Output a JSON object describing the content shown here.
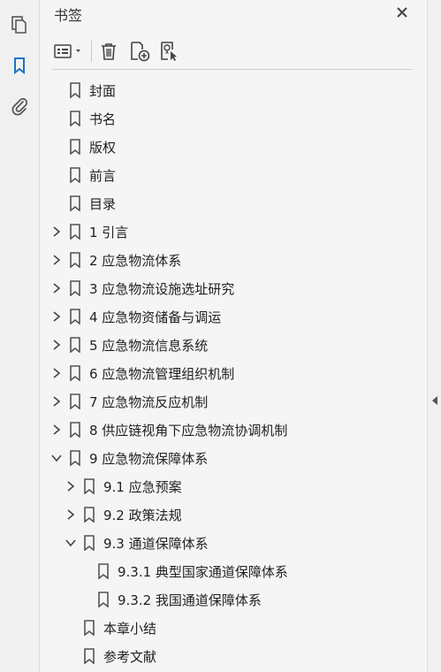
{
  "panel": {
    "title": "书签"
  },
  "rail": {
    "items": [
      "pages-icon",
      "bookmarks-icon",
      "attachments-icon"
    ]
  },
  "toolbar": {
    "items": [
      "options-menu",
      "delete-bookmark",
      "new-bookmark",
      "new-bookmark-from-structure"
    ]
  },
  "bookmarks": [
    {
      "label": "封面",
      "level": 0,
      "expander": "none"
    },
    {
      "label": "书名",
      "level": 0,
      "expander": "none"
    },
    {
      "label": "版权",
      "level": 0,
      "expander": "none"
    },
    {
      "label": "前言",
      "level": 0,
      "expander": "none"
    },
    {
      "label": "目录",
      "level": 0,
      "expander": "none"
    },
    {
      "label": "1  引言",
      "level": 0,
      "expander": "collapsed"
    },
    {
      "label": "2  应急物流体系",
      "level": 0,
      "expander": "collapsed"
    },
    {
      "label": "3  应急物流设施选址研究",
      "level": 0,
      "expander": "collapsed"
    },
    {
      "label": "4  应急物资储备与调运",
      "level": 0,
      "expander": "collapsed"
    },
    {
      "label": "5  应急物流信息系统",
      "level": 0,
      "expander": "collapsed"
    },
    {
      "label": "6  应急物流管理组织机制",
      "level": 0,
      "expander": "collapsed"
    },
    {
      "label": "7  应急物流反应机制",
      "level": 0,
      "expander": "collapsed"
    },
    {
      "label": "8  供应链视角下应急物流协调机制",
      "level": 0,
      "expander": "collapsed"
    },
    {
      "label": "9  应急物流保障体系",
      "level": 0,
      "expander": "expanded"
    },
    {
      "label": "9.1  应急预案",
      "level": 1,
      "expander": "collapsed"
    },
    {
      "label": "9.2  政策法规",
      "level": 1,
      "expander": "collapsed"
    },
    {
      "label": "9.3  通道保障体系",
      "level": 1,
      "expander": "expanded"
    },
    {
      "label": "9.3.1  典型国家通道保障体系",
      "level": 2,
      "expander": "none"
    },
    {
      "label": "9.3.2  我国通道保障体系",
      "level": 2,
      "expander": "none"
    },
    {
      "label": "本章小结",
      "level": 1,
      "expander": "none"
    },
    {
      "label": "参考文献",
      "level": 1,
      "expander": "none"
    }
  ]
}
